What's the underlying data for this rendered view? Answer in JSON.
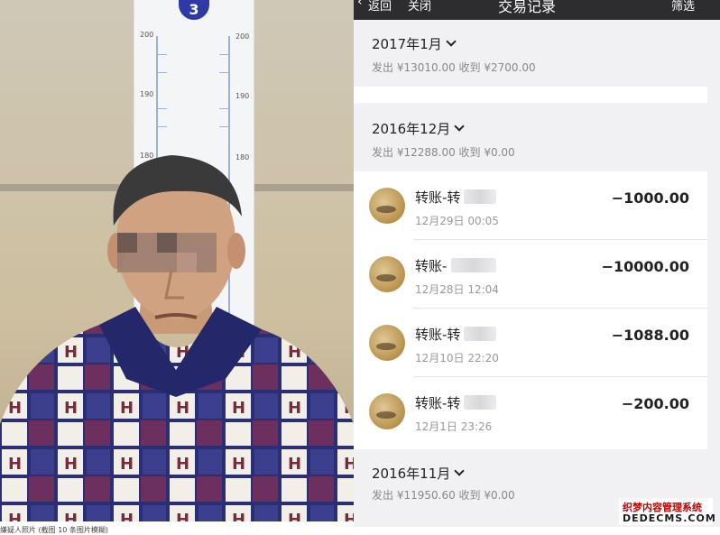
{
  "photo": {
    "height_chart_badge": "3",
    "left_ticks": [
      "200",
      "190",
      "180"
    ],
    "right_ticks": [
      "200",
      "190",
      "180"
    ],
    "caption": "嫌疑人照片 (截图 10 条图片模糊)"
  },
  "topbar": {
    "back_label": "返回",
    "close_label": "关闭",
    "title": "交易记录",
    "filter_label": "筛选"
  },
  "months": [
    {
      "title": "2017年1月",
      "summary": "发出 ¥13010.00 收到 ¥2700.00"
    },
    {
      "title": "2016年12月",
      "summary": "发出 ¥12288.00 收到 ¥0.00"
    },
    {
      "title": "2016年11月",
      "summary": "发出 ¥11950.60 收到 ¥0.00"
    }
  ],
  "transactions": [
    {
      "name": "转账-转",
      "time": "12月29日 00:05",
      "amount": "−1000.00"
    },
    {
      "name": "转账-",
      "time": "12月28日 12:04",
      "amount": "−10000.00"
    },
    {
      "name": "转账-转",
      "time": "12月10日 22:20",
      "amount": "−1088.00"
    },
    {
      "name": "转账-转",
      "time": "12月1日 23:26",
      "amount": "−200.00"
    }
  ],
  "watermark": {
    "line1": "织梦内容管理系统",
    "line2": "DEDECMS.COM"
  }
}
